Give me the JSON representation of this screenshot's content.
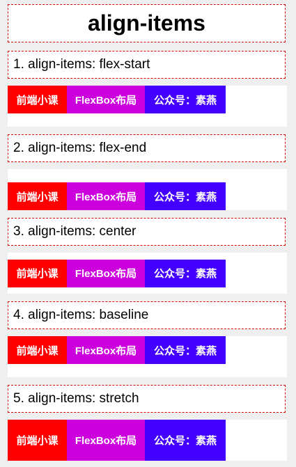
{
  "page_title": "align-items",
  "colors": {
    "item1": "#ff0000",
    "item2": "#cc00dd",
    "item3": "#4400ff",
    "border": "#d40000"
  },
  "sections": [
    {
      "label": "1. align-items: flex-start",
      "items": [
        "前端小课",
        "FlexBox布局",
        "公众号：素燕"
      ]
    },
    {
      "label": "2. align-items: flex-end",
      "items": [
        "前端小课",
        "FlexBox布局",
        "公众号：素燕"
      ]
    },
    {
      "label": "3. align-items: center",
      "items": [
        "前端小课",
        "FlexBox布局",
        "公众号：素燕"
      ]
    },
    {
      "label": "4. align-items: baseline",
      "items": [
        "前端小课",
        "FlexBox布局",
        "公众号：素燕"
      ]
    },
    {
      "label": "5. align-items: stretch",
      "items": [
        "前端小课",
        "FlexBox布局",
        "公众号：素燕"
      ]
    }
  ]
}
